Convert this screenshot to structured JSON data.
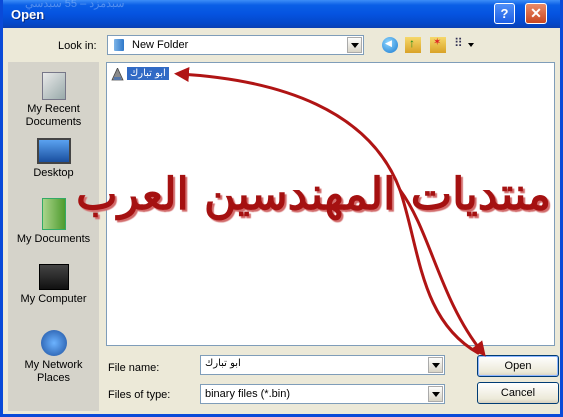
{
  "window": {
    "title": "Open",
    "faint_header": "سبدمزد – 55 سبدسي",
    "help_button": "?",
    "close_button": "✕"
  },
  "toolbar": {
    "lookin_label": "Look in:",
    "lookin_value": "New Folder",
    "tools": [
      "back-icon",
      "up-folder-icon",
      "new-folder-icon",
      "view-menu-icon"
    ]
  },
  "places": [
    {
      "label": "My Recent Documents",
      "icon": "recent-documents-icon"
    },
    {
      "label": "Desktop",
      "icon": "desktop-icon"
    },
    {
      "label": "My Documents",
      "icon": "my-documents-icon"
    },
    {
      "label": "My Computer",
      "icon": "my-computer-icon"
    },
    {
      "label": "My Network Places",
      "icon": "network-places-icon"
    }
  ],
  "files": [
    {
      "name": "ابو تبارك",
      "selected": true
    }
  ],
  "watermark": "منتديات المهندسين العرب",
  "form": {
    "filename_label": "File name:",
    "filename_value": "ابو تبارك",
    "filetype_label": "Files of type:",
    "filetype_value": "binary files (*.bin)"
  },
  "buttons": {
    "open": "Open",
    "cancel": "Cancel"
  },
  "colors": {
    "titlebar": "#0553e0",
    "selection": "#316ac5",
    "watermark": "#a51111",
    "arrow": "#b01414"
  }
}
